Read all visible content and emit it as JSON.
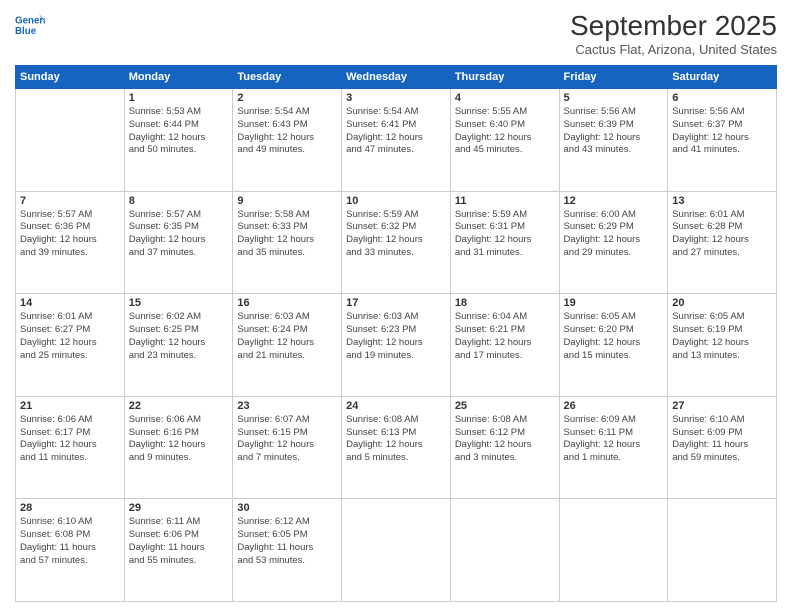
{
  "header": {
    "logo_line1": "General",
    "logo_line2": "Blue",
    "month": "September 2025",
    "location": "Cactus Flat, Arizona, United States"
  },
  "weekdays": [
    "Sunday",
    "Monday",
    "Tuesday",
    "Wednesday",
    "Thursday",
    "Friday",
    "Saturday"
  ],
  "weeks": [
    [
      {
        "day": "",
        "info": ""
      },
      {
        "day": "1",
        "info": "Sunrise: 5:53 AM\nSunset: 6:44 PM\nDaylight: 12 hours\nand 50 minutes."
      },
      {
        "day": "2",
        "info": "Sunrise: 5:54 AM\nSunset: 6:43 PM\nDaylight: 12 hours\nand 49 minutes."
      },
      {
        "day": "3",
        "info": "Sunrise: 5:54 AM\nSunset: 6:41 PM\nDaylight: 12 hours\nand 47 minutes."
      },
      {
        "day": "4",
        "info": "Sunrise: 5:55 AM\nSunset: 6:40 PM\nDaylight: 12 hours\nand 45 minutes."
      },
      {
        "day": "5",
        "info": "Sunrise: 5:56 AM\nSunset: 6:39 PM\nDaylight: 12 hours\nand 43 minutes."
      },
      {
        "day": "6",
        "info": "Sunrise: 5:56 AM\nSunset: 6:37 PM\nDaylight: 12 hours\nand 41 minutes."
      }
    ],
    [
      {
        "day": "7",
        "info": "Sunrise: 5:57 AM\nSunset: 6:36 PM\nDaylight: 12 hours\nand 39 minutes."
      },
      {
        "day": "8",
        "info": "Sunrise: 5:57 AM\nSunset: 6:35 PM\nDaylight: 12 hours\nand 37 minutes."
      },
      {
        "day": "9",
        "info": "Sunrise: 5:58 AM\nSunset: 6:33 PM\nDaylight: 12 hours\nand 35 minutes."
      },
      {
        "day": "10",
        "info": "Sunrise: 5:59 AM\nSunset: 6:32 PM\nDaylight: 12 hours\nand 33 minutes."
      },
      {
        "day": "11",
        "info": "Sunrise: 5:59 AM\nSunset: 6:31 PM\nDaylight: 12 hours\nand 31 minutes."
      },
      {
        "day": "12",
        "info": "Sunrise: 6:00 AM\nSunset: 6:29 PM\nDaylight: 12 hours\nand 29 minutes."
      },
      {
        "day": "13",
        "info": "Sunrise: 6:01 AM\nSunset: 6:28 PM\nDaylight: 12 hours\nand 27 minutes."
      }
    ],
    [
      {
        "day": "14",
        "info": "Sunrise: 6:01 AM\nSunset: 6:27 PM\nDaylight: 12 hours\nand 25 minutes."
      },
      {
        "day": "15",
        "info": "Sunrise: 6:02 AM\nSunset: 6:25 PM\nDaylight: 12 hours\nand 23 minutes."
      },
      {
        "day": "16",
        "info": "Sunrise: 6:03 AM\nSunset: 6:24 PM\nDaylight: 12 hours\nand 21 minutes."
      },
      {
        "day": "17",
        "info": "Sunrise: 6:03 AM\nSunset: 6:23 PM\nDaylight: 12 hours\nand 19 minutes."
      },
      {
        "day": "18",
        "info": "Sunrise: 6:04 AM\nSunset: 6:21 PM\nDaylight: 12 hours\nand 17 minutes."
      },
      {
        "day": "19",
        "info": "Sunrise: 6:05 AM\nSunset: 6:20 PM\nDaylight: 12 hours\nand 15 minutes."
      },
      {
        "day": "20",
        "info": "Sunrise: 6:05 AM\nSunset: 6:19 PM\nDaylight: 12 hours\nand 13 minutes."
      }
    ],
    [
      {
        "day": "21",
        "info": "Sunrise: 6:06 AM\nSunset: 6:17 PM\nDaylight: 12 hours\nand 11 minutes."
      },
      {
        "day": "22",
        "info": "Sunrise: 6:06 AM\nSunset: 6:16 PM\nDaylight: 12 hours\nand 9 minutes."
      },
      {
        "day": "23",
        "info": "Sunrise: 6:07 AM\nSunset: 6:15 PM\nDaylight: 12 hours\nand 7 minutes."
      },
      {
        "day": "24",
        "info": "Sunrise: 6:08 AM\nSunset: 6:13 PM\nDaylight: 12 hours\nand 5 minutes."
      },
      {
        "day": "25",
        "info": "Sunrise: 6:08 AM\nSunset: 6:12 PM\nDaylight: 12 hours\nand 3 minutes."
      },
      {
        "day": "26",
        "info": "Sunrise: 6:09 AM\nSunset: 6:11 PM\nDaylight: 12 hours\nand 1 minute."
      },
      {
        "day": "27",
        "info": "Sunrise: 6:10 AM\nSunset: 6:09 PM\nDaylight: 11 hours\nand 59 minutes."
      }
    ],
    [
      {
        "day": "28",
        "info": "Sunrise: 6:10 AM\nSunset: 6:08 PM\nDaylight: 11 hours\nand 57 minutes."
      },
      {
        "day": "29",
        "info": "Sunrise: 6:11 AM\nSunset: 6:06 PM\nDaylight: 11 hours\nand 55 minutes."
      },
      {
        "day": "30",
        "info": "Sunrise: 6:12 AM\nSunset: 6:05 PM\nDaylight: 11 hours\nand 53 minutes."
      },
      {
        "day": "",
        "info": ""
      },
      {
        "day": "",
        "info": ""
      },
      {
        "day": "",
        "info": ""
      },
      {
        "day": "",
        "info": ""
      }
    ]
  ]
}
